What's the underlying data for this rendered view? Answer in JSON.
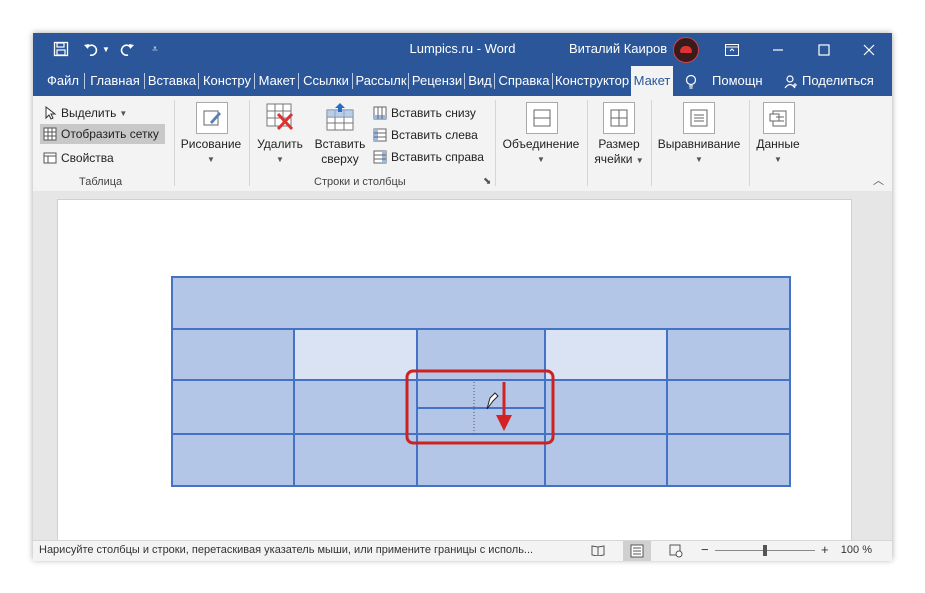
{
  "titlebar": {
    "title": "Lumpics.ru  -  Word",
    "user": "Виталий Каиров",
    "qat_icons": [
      "save-icon",
      "undo-icon",
      "undo-dropdown-icon",
      "redo-icon",
      "customize-qat-icon"
    ],
    "window_icons": [
      "ribbon-display-icon",
      "minimize-icon",
      "maximize-icon",
      "close-icon"
    ]
  },
  "tabs": {
    "items": [
      "Файл",
      "Главная",
      "Вставка",
      "Констру",
      "Макет",
      "Ссылки",
      "Рассылк",
      "Рецензи",
      "Вид",
      "Справка",
      "Конструктор",
      "Макет"
    ],
    "active": "Макет",
    "help": "Помощн",
    "share": "Поделиться"
  },
  "ribbon": {
    "table_group": {
      "select": "Выделить",
      "gridlines": "Отобразить сетку",
      "properties": "Свойства",
      "label": "Таблица"
    },
    "draw": "Рисование",
    "rows_cols": {
      "delete": "Удалить",
      "insert_above_1": "Вставить",
      "insert_above_2": "сверху",
      "insert_below": "Вставить снизу",
      "insert_left": "Вставить слева",
      "insert_right": "Вставить справа",
      "label": "Строки и столбцы"
    },
    "merge": "Объединение",
    "cell_size_1": "Размер",
    "cell_size_2": "ячейки",
    "alignment": "Выравнивание",
    "data": "Данные"
  },
  "colors": {
    "accent": "#2b579a",
    "table_border": "#4472c4",
    "cell_fill": "#b4c6e7",
    "cell_fill_light": "#dae3f3",
    "highlight_border": "#cc2222",
    "arrow": "#d32222"
  },
  "status": {
    "text": "Нарисуйте столбцы и строки, перетаскивая указатель мыши, или примените границы с исполь...",
    "zoom": "100 %"
  }
}
